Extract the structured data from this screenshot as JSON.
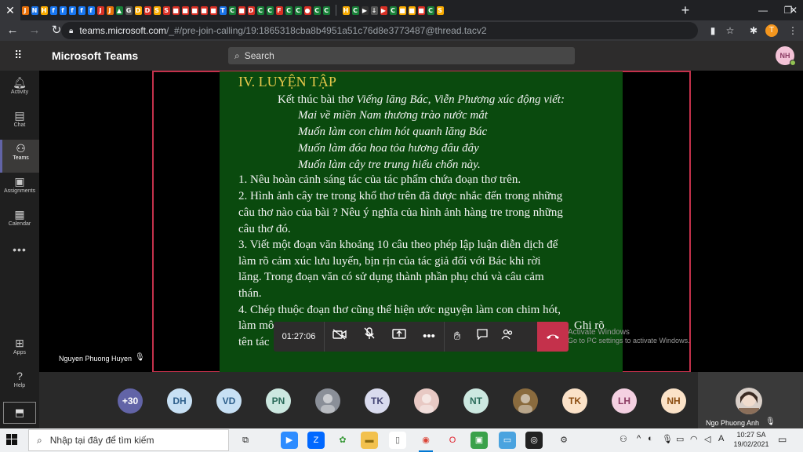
{
  "browser": {
    "close_tab": "✕",
    "new_tab": "+",
    "window_buttons": [
      "—",
      "❐",
      "✕"
    ],
    "url_host": "teams.microsoft.com",
    "url_path": "/_#/pre-join-calling/19:1865318cba8b4951a51c76d8e3773487@thread.tacv2",
    "profile_initial": "T",
    "tab_favicons": [
      {
        "glyph": "J",
        "color": "#e8710a"
      },
      {
        "glyph": "N",
        "color": "#1a73e8"
      },
      {
        "glyph": "H",
        "color": "#f9ab00"
      },
      {
        "glyph": "f",
        "color": "#1877f2"
      },
      {
        "glyph": "f",
        "color": "#1877f2"
      },
      {
        "glyph": "f",
        "color": "#1877f2"
      },
      {
        "glyph": "f",
        "color": "#1877f2"
      },
      {
        "glyph": "f",
        "color": "#1877f2"
      },
      {
        "glyph": "J",
        "color": "#d93025"
      },
      {
        "glyph": "J",
        "color": "#e8710a"
      },
      {
        "glyph": "▲",
        "color": "#188038"
      },
      {
        "glyph": "G",
        "color": "#555"
      },
      {
        "glyph": "D",
        "color": "#f9ab00"
      },
      {
        "glyph": "D",
        "color": "#d93025"
      },
      {
        "glyph": "S",
        "color": "#f9ab00"
      },
      {
        "glyph": "S",
        "color": "#d93025"
      },
      {
        "glyph": "■",
        "color": "#d93025"
      },
      {
        "glyph": "■",
        "color": "#d93025"
      },
      {
        "glyph": "■",
        "color": "#d93025"
      },
      {
        "glyph": "■",
        "color": "#d93025"
      },
      {
        "glyph": "■",
        "color": "#d93025"
      },
      {
        "glyph": "T",
        "color": "#1a73e8"
      },
      {
        "glyph": "C",
        "color": "#188038"
      },
      {
        "glyph": "■",
        "color": "#d93025"
      },
      {
        "glyph": "D",
        "color": "#d93025"
      },
      {
        "glyph": "C",
        "color": "#188038"
      },
      {
        "glyph": "C",
        "color": "#188038"
      },
      {
        "glyph": "F",
        "color": "#d93025"
      },
      {
        "glyph": "C",
        "color": "#188038"
      },
      {
        "glyph": "C",
        "color": "#188038"
      },
      {
        "glyph": "●",
        "color": "#d93025"
      },
      {
        "glyph": "C",
        "color": "#188038"
      },
      {
        "glyph": "C",
        "color": "#188038"
      },
      {
        "glyph": "H",
        "color": "#f9ab00"
      },
      {
        "glyph": "C",
        "color": "#188038"
      },
      {
        "glyph": "▶",
        "color": "#333"
      },
      {
        "glyph": "↓",
        "color": "#555"
      },
      {
        "glyph": "▶",
        "color": "#d93025"
      },
      {
        "glyph": "C",
        "color": "#188038"
      },
      {
        "glyph": "■",
        "color": "#f9ab00"
      },
      {
        "glyph": "■",
        "color": "#f9ab00"
      },
      {
        "glyph": "■",
        "color": "#d93025"
      },
      {
        "glyph": "C",
        "color": "#188038"
      },
      {
        "glyph": "S",
        "color": "#f9ab00"
      }
    ]
  },
  "teams": {
    "app_title": "Microsoft Teams",
    "search_placeholder": "Search",
    "user_initials": "NH"
  },
  "rail": [
    {
      "label": "Activity",
      "icon": "bell-icon",
      "glyph": "🔔︎"
    },
    {
      "label": "Chat",
      "icon": "chat-icon",
      "glyph": "▤"
    },
    {
      "label": "Teams",
      "icon": "teams-icon",
      "glyph": "⚇",
      "active": true
    },
    {
      "label": "Assignments",
      "icon": "assignments-icon",
      "glyph": "▣"
    },
    {
      "label": "Calendar",
      "icon": "calendar-icon",
      "glyph": "▦"
    }
  ],
  "rail_more": "•••",
  "rail_bottom": [
    {
      "label": "Apps",
      "icon": "apps-icon",
      "glyph": "⊞"
    },
    {
      "label": "Help",
      "icon": "help-icon",
      "glyph": "?"
    }
  ],
  "slide": {
    "title": "IV. LUYỆN TẬP",
    "intro_prefix": "Kết thúc bài thơ ",
    "intro_italic": "Viếng lăng Bác, Viễn Phương xúc động viết:",
    "poem": [
      "Mai về miền Nam thương trào nước mắt",
      "Muốn làm con chim hót quanh lăng Bác",
      "Muốn làm đóa hoa tỏa hương đâu đây",
      "Muốn làm cây tre trung hiếu chốn này."
    ],
    "body": [
      "1. Nêu hoàn cảnh sáng tác của tác phẩm chứa đoạn thơ trên.",
      "2. Hình ảnh cây tre trong khổ thơ trên đã được nhắc đến trong những",
      "câu thơ nào của bài ? Nêu ý nghĩa của hình ảnh hàng tre trong những",
      "câu thơ đó.",
      "3. Viết một đoạn văn khoảng 10 câu theo phép lập luận diễn dịch để",
      "làm rõ cảm xúc lưu luyến, bịn rịn của tác giả đối với Bác khi rời",
      "lăng. Trong đoạn văn có sử dụng thành phần phụ chú và câu cảm",
      "thán.",
      "4. Chép thuộc đoạn thơ cũng thể hiện ước nguyện làm con chim hót,",
      "làm mô",
      "tên tác"
    ],
    "body_tail": "Ghi rõ"
  },
  "presenter_name": "Nguyen Phuong Huyen",
  "controls": {
    "timer": "01:27:06"
  },
  "watermark": [
    "Activate Windows",
    "Go to PC settings to activate Windows."
  ],
  "participants": [
    {
      "initials": "+30",
      "bg": "#6264a7",
      "fg": "#ffffff"
    },
    {
      "initials": "DH",
      "bg": "#c7e0f4",
      "fg": "#2d5f8b"
    },
    {
      "initials": "VD",
      "bg": "#c7e0f4",
      "fg": "#2d5f8b"
    },
    {
      "initials": "PN",
      "bg": "#cce8e0",
      "fg": "#2a6b5a"
    },
    {
      "photo": true,
      "photo_bg": "#8a8f98"
    },
    {
      "initials": "TK",
      "bg": "#d9dbee",
      "fg": "#464775"
    },
    {
      "photo": true,
      "photo_bg": "#e8c9c4"
    },
    {
      "initials": "NT",
      "bg": "#cce8e0",
      "fg": "#2a6b5a"
    },
    {
      "photo": true,
      "photo_bg": "#8a6b3e"
    },
    {
      "initials": "TK",
      "bg": "#fbe2c8",
      "fg": "#8a4b0f"
    },
    {
      "initials": "LH",
      "bg": "#f4d0e1",
      "fg": "#8b3a62"
    },
    {
      "initials": "NH",
      "bg": "#fbe2c8",
      "fg": "#8a4b0f"
    }
  ],
  "self_tile": {
    "name": "Ngo Phuong Anh"
  },
  "taskbar": {
    "search_placeholder": "Nhập tại đây để tìm kiếm",
    "apps": [
      {
        "name": "task-view-icon",
        "glyph": "⧉",
        "bg": "transparent",
        "fg": "#222"
      },
      {
        "name": "zoom-icon",
        "glyph": "▶",
        "bg": "#2d8cff",
        "fg": "#fff"
      },
      {
        "name": "zalo-icon",
        "glyph": "Z",
        "bg": "#0068ff",
        "fg": "#fff"
      },
      {
        "name": "clover-icon",
        "glyph": "✿",
        "bg": "transparent",
        "fg": "#3a9a3a"
      },
      {
        "name": "file-explorer-icon",
        "glyph": "▬",
        "bg": "#f2c14e",
        "fg": "#8a6a10"
      },
      {
        "name": "notes-icon",
        "glyph": "▯",
        "bg": "#ffffff",
        "fg": "#666"
      },
      {
        "name": "chrome-icon",
        "glyph": "◉",
        "bg": "transparent",
        "fg": "#db4437",
        "active": true
      },
      {
        "name": "opera-icon",
        "glyph": "O",
        "bg": "transparent",
        "fg": "#e0232e"
      },
      {
        "name": "game-icon",
        "glyph": "▣",
        "bg": "#3aa14a",
        "fg": "#fff"
      },
      {
        "name": "monitor-icon",
        "glyph": "▭",
        "bg": "#4aa3df",
        "fg": "#fff"
      },
      {
        "name": "media-icon",
        "glyph": "◎",
        "bg": "#222",
        "fg": "#fff"
      },
      {
        "name": "settings-icon",
        "glyph": "⚙",
        "bg": "transparent",
        "fg": "#333"
      }
    ],
    "time": "10:27 SA",
    "date": "19/02/2021"
  }
}
